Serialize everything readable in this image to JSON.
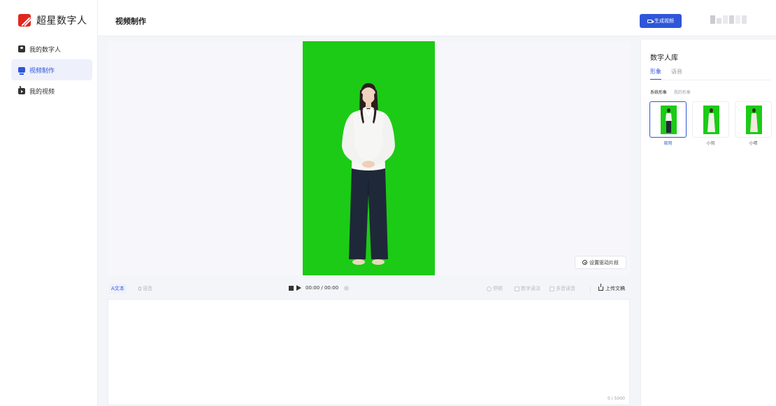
{
  "app": {
    "name": "超星数字人"
  },
  "sidebar": {
    "items": [
      {
        "label": "我的数字人",
        "icon": "person-card-icon",
        "active": false
      },
      {
        "label": "视频制作",
        "icon": "monitor-icon",
        "active": true
      },
      {
        "label": "我的视频",
        "icon": "tv-icon",
        "active": false
      }
    ]
  },
  "header": {
    "title": "视频制作",
    "generate_label": "生成视频"
  },
  "stage": {
    "drive_label": "设置驱动片段",
    "background_color": "#1ccb16"
  },
  "toolbar": {
    "text_tab": "文本",
    "text_prefix": "A",
    "audio_tab": "语音",
    "timecode": "00:00 / 00:00",
    "pause_label": "停顿",
    "number_label": "数字读法",
    "polyphone_label": "多音读音",
    "upload_label": "上传文稿"
  },
  "editor": {
    "counter": "0 / 5000"
  },
  "library": {
    "title": "数字人库",
    "tabs": [
      "形象",
      "语音"
    ],
    "subtabs": [
      "系统形象",
      "我的形象"
    ],
    "avatars": [
      {
        "name": "晓玥",
        "selected": true
      },
      {
        "name": "小玥",
        "selected": false
      },
      {
        "name": "小晴",
        "selected": false
      }
    ]
  },
  "colors": {
    "accent": "#2f56d8",
    "logo": "#e0271f",
    "greenscreen": "#1ccb16"
  }
}
